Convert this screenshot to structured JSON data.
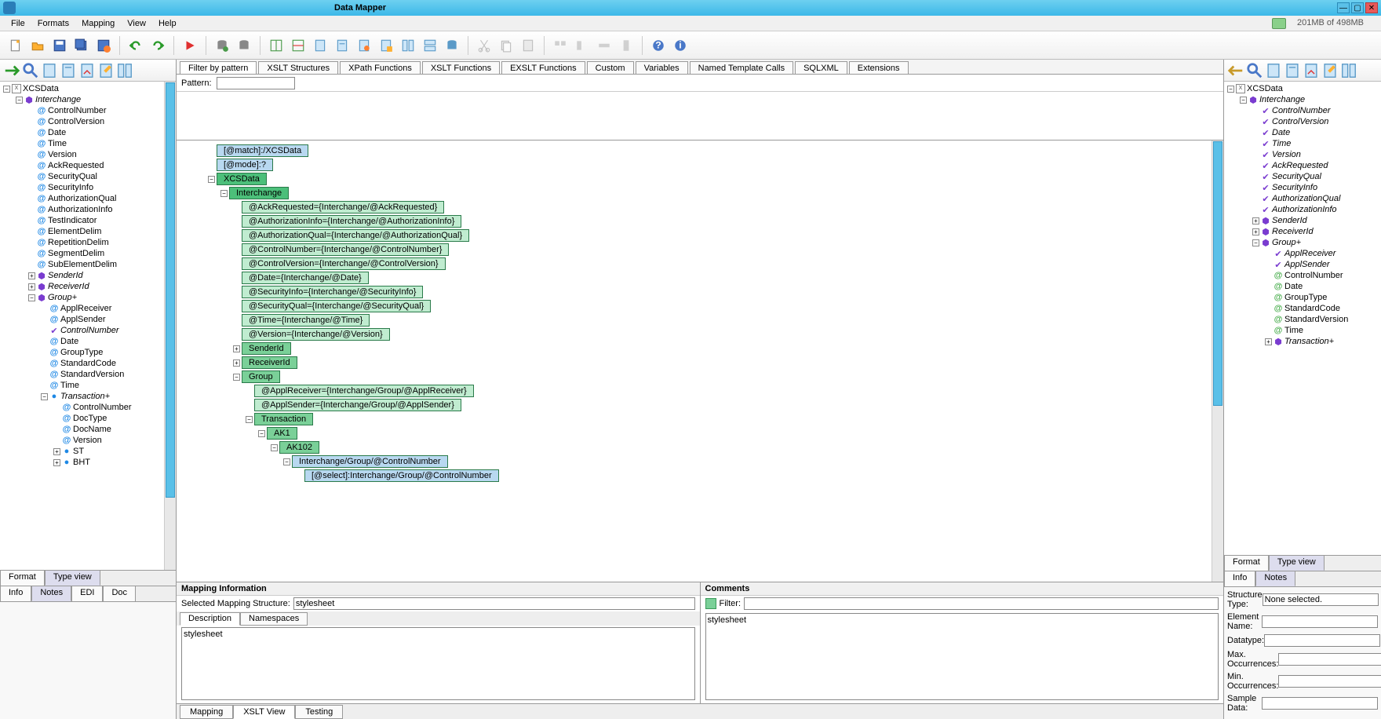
{
  "title": "Data Mapper",
  "memory": "201MB of 498MB",
  "menu": [
    "File",
    "Formats",
    "Mapping",
    "View",
    "Help"
  ],
  "center_tabs": [
    "Filter by pattern",
    "XSLT Structures",
    "XPath Functions",
    "XSLT Functions",
    "EXSLT Functions",
    "Custom",
    "Variables",
    "Named Template Calls",
    "SQLXML",
    "Extensions"
  ],
  "pattern_label": "Pattern:",
  "left_btabs1": [
    "Format",
    "Type view"
  ],
  "left_btabs2": [
    "Info",
    "Notes",
    "EDI",
    "Doc"
  ],
  "right_btabs1": [
    "Format",
    "Type view"
  ],
  "right_btabs2": [
    "Info",
    "Notes"
  ],
  "center_btabs": [
    "Mapping",
    "XSLT View",
    "Testing"
  ],
  "mapping_info": {
    "title": "Mapping Information",
    "sel_label": "Selected Mapping Structure:",
    "sel_value": "stylesheet",
    "sub_tabs": [
      "Description",
      "Namespaces"
    ],
    "desc": "stylesheet"
  },
  "comments": {
    "title": "Comments",
    "filter_label": "Filter:",
    "body": "stylesheet"
  },
  "right_details": {
    "structure_type": {
      "label": "Structure Type:",
      "value": "None selected."
    },
    "element_name": {
      "label": "Element Name:",
      "value": ""
    },
    "datatype": {
      "label": "Datatype:",
      "value": ""
    },
    "max_occ": {
      "label": "Max. Occurrences:",
      "value": ""
    },
    "min_occ": {
      "label": "Min. Occurrences:",
      "value": ""
    },
    "sample": {
      "label": "Sample Data:",
      "value": ""
    }
  },
  "left_tree": [
    {
      "d": 0,
      "tog": "-",
      "ico": "x",
      "t": "XCSData",
      "it": false
    },
    {
      "d": 1,
      "tog": "-",
      "ico": "shield",
      "t": "Interchange",
      "it": true
    },
    {
      "d": 2,
      "tog": "",
      "ico": "at",
      "t": "ControlNumber"
    },
    {
      "d": 2,
      "tog": "",
      "ico": "at",
      "t": "ControlVersion"
    },
    {
      "d": 2,
      "tog": "",
      "ico": "at",
      "t": "Date"
    },
    {
      "d": 2,
      "tog": "",
      "ico": "at",
      "t": "Time"
    },
    {
      "d": 2,
      "tog": "",
      "ico": "at",
      "t": "Version"
    },
    {
      "d": 2,
      "tog": "",
      "ico": "at",
      "t": "AckRequested"
    },
    {
      "d": 2,
      "tog": "",
      "ico": "at",
      "t": "SecurityQual"
    },
    {
      "d": 2,
      "tog": "",
      "ico": "at",
      "t": "SecurityInfo"
    },
    {
      "d": 2,
      "tog": "",
      "ico": "at",
      "t": "AuthorizationQual"
    },
    {
      "d": 2,
      "tog": "",
      "ico": "at",
      "t": "AuthorizationInfo"
    },
    {
      "d": 2,
      "tog": "",
      "ico": "at",
      "t": "TestIndicator"
    },
    {
      "d": 2,
      "tog": "",
      "ico": "at",
      "t": "ElementDelim"
    },
    {
      "d": 2,
      "tog": "",
      "ico": "at",
      "t": "RepetitionDelim"
    },
    {
      "d": 2,
      "tog": "",
      "ico": "at",
      "t": "SegmentDelim"
    },
    {
      "d": 2,
      "tog": "",
      "ico": "at",
      "t": "SubElementDelim"
    },
    {
      "d": 2,
      "tog": "+",
      "ico": "shield",
      "t": "SenderId",
      "it": true
    },
    {
      "d": 2,
      "tog": "+",
      "ico": "shield",
      "t": "ReceiverId",
      "it": true
    },
    {
      "d": 2,
      "tog": "-",
      "ico": "shield",
      "t": "Group+",
      "it": true
    },
    {
      "d": 3,
      "tog": "",
      "ico": "at",
      "t": "ApplReceiver"
    },
    {
      "d": 3,
      "tog": "",
      "ico": "at",
      "t": "ApplSender"
    },
    {
      "d": 3,
      "tog": "",
      "ico": "check",
      "t": "ControlNumber",
      "it": true
    },
    {
      "d": 3,
      "tog": "",
      "ico": "at",
      "t": "Date"
    },
    {
      "d": 3,
      "tog": "",
      "ico": "at",
      "t": "GroupType"
    },
    {
      "d": 3,
      "tog": "",
      "ico": "at",
      "t": "StandardCode"
    },
    {
      "d": 3,
      "tog": "",
      "ico": "at",
      "t": "StandardVersion"
    },
    {
      "d": 3,
      "tog": "",
      "ico": "at",
      "t": "Time"
    },
    {
      "d": 3,
      "tog": "-",
      "ico": "dot",
      "t": "Transaction+",
      "it": true
    },
    {
      "d": 4,
      "tog": "",
      "ico": "at",
      "t": "ControlNumber"
    },
    {
      "d": 4,
      "tog": "",
      "ico": "at",
      "t": "DocType"
    },
    {
      "d": 4,
      "tog": "",
      "ico": "at",
      "t": "DocName"
    },
    {
      "d": 4,
      "tog": "",
      "ico": "at",
      "t": "Version"
    },
    {
      "d": 4,
      "tog": "+",
      "ico": "dot",
      "t": "ST"
    },
    {
      "d": 4,
      "tog": "+",
      "ico": "dot",
      "t": "BHT"
    }
  ],
  "right_tree": [
    {
      "d": 0,
      "tog": "-",
      "ico": "x",
      "t": "XCSData",
      "it": false
    },
    {
      "d": 1,
      "tog": "-",
      "ico": "shield",
      "t": "Interchange",
      "it": true
    },
    {
      "d": 2,
      "tog": "",
      "ico": "check",
      "t": "ControlNumber",
      "it": true
    },
    {
      "d": 2,
      "tog": "",
      "ico": "check",
      "t": "ControlVersion",
      "it": true
    },
    {
      "d": 2,
      "tog": "",
      "ico": "check",
      "t": "Date",
      "it": true
    },
    {
      "d": 2,
      "tog": "",
      "ico": "check",
      "t": "Time",
      "it": true
    },
    {
      "d": 2,
      "tog": "",
      "ico": "check",
      "t": "Version",
      "it": true
    },
    {
      "d": 2,
      "tog": "",
      "ico": "check",
      "t": "AckRequested",
      "it": true
    },
    {
      "d": 2,
      "tog": "",
      "ico": "check",
      "t": "SecurityQual",
      "it": true
    },
    {
      "d": 2,
      "tog": "",
      "ico": "check",
      "t": "SecurityInfo",
      "it": true
    },
    {
      "d": 2,
      "tog": "",
      "ico": "check",
      "t": "AuthorizationQual",
      "it": true
    },
    {
      "d": 2,
      "tog": "",
      "ico": "check",
      "t": "AuthorizationInfo",
      "it": true
    },
    {
      "d": 2,
      "tog": "+",
      "ico": "shield",
      "t": "SenderId",
      "it": true
    },
    {
      "d": 2,
      "tog": "+",
      "ico": "shield",
      "t": "ReceiverId",
      "it": true
    },
    {
      "d": 2,
      "tog": "-",
      "ico": "shield",
      "t": "Group+",
      "it": true
    },
    {
      "d": 3,
      "tog": "",
      "ico": "check",
      "t": "ApplReceiver",
      "it": true
    },
    {
      "d": 3,
      "tog": "",
      "ico": "check",
      "t": "ApplSender",
      "it": true
    },
    {
      "d": 3,
      "tog": "",
      "ico": "atg",
      "t": "ControlNumber"
    },
    {
      "d": 3,
      "tog": "",
      "ico": "atg",
      "t": "Date"
    },
    {
      "d": 3,
      "tog": "",
      "ico": "atg",
      "t": "GroupType"
    },
    {
      "d": 3,
      "tog": "",
      "ico": "atg",
      "t": "StandardCode"
    },
    {
      "d": 3,
      "tog": "",
      "ico": "atg",
      "t": "StandardVersion"
    },
    {
      "d": 3,
      "tog": "",
      "ico": "atg",
      "t": "Time"
    },
    {
      "d": 3,
      "tog": "+",
      "ico": "shield",
      "t": "Transaction+",
      "it": true
    }
  ],
  "map_nodes": [
    {
      "d": 0,
      "tog": "",
      "cls": "blue",
      "t": "[@match]:/XCSData"
    },
    {
      "d": 0,
      "tog": "",
      "cls": "blue",
      "t": "[@mode]:?"
    },
    {
      "d": 0,
      "tog": "-",
      "cls": "dk",
      "t": "XCSData"
    },
    {
      "d": 1,
      "tog": "-",
      "cls": "dk",
      "t": "Interchange"
    },
    {
      "d": 2,
      "tog": "",
      "cls": "lt",
      "t": "@AckRequested={Interchange/@AckRequested}"
    },
    {
      "d": 2,
      "tog": "",
      "cls": "lt",
      "t": "@AuthorizationInfo={Interchange/@AuthorizationInfo}"
    },
    {
      "d": 2,
      "tog": "",
      "cls": "lt",
      "t": "@AuthorizationQual={Interchange/@AuthorizationQual}"
    },
    {
      "d": 2,
      "tog": "",
      "cls": "lt",
      "t": "@ControlNumber={Interchange/@ControlNumber}"
    },
    {
      "d": 2,
      "tog": "",
      "cls": "lt",
      "t": "@ControlVersion={Interchange/@ControlVersion}"
    },
    {
      "d": 2,
      "tog": "",
      "cls": "lt",
      "t": "@Date={Interchange/@Date}"
    },
    {
      "d": 2,
      "tog": "",
      "cls": "lt",
      "t": "@SecurityInfo={Interchange/@SecurityInfo}"
    },
    {
      "d": 2,
      "tog": "",
      "cls": "lt",
      "t": "@SecurityQual={Interchange/@SecurityQual}"
    },
    {
      "d": 2,
      "tog": "",
      "cls": "lt",
      "t": "@Time={Interchange/@Time}"
    },
    {
      "d": 2,
      "tog": "",
      "cls": "lt",
      "t": "@Version={Interchange/@Version}"
    },
    {
      "d": 2,
      "tog": "+",
      "cls": "md",
      "t": "SenderId"
    },
    {
      "d": 2,
      "tog": "+",
      "cls": "md",
      "t": "ReceiverId"
    },
    {
      "d": 2,
      "tog": "-",
      "cls": "md",
      "t": "Group"
    },
    {
      "d": 3,
      "tog": "",
      "cls": "lt",
      "t": "@ApplReceiver={Interchange/Group/@ApplReceiver}"
    },
    {
      "d": 3,
      "tog": "",
      "cls": "lt",
      "t": "@ApplSender={Interchange/Group/@ApplSender}"
    },
    {
      "d": 3,
      "tog": "-",
      "cls": "md",
      "t": "Transaction"
    },
    {
      "d": 4,
      "tog": "-",
      "cls": "md",
      "t": "AK1"
    },
    {
      "d": 5,
      "tog": "-",
      "cls": "md",
      "t": "AK102"
    },
    {
      "d": 6,
      "tog": "-",
      "cls": "blue",
      "t": "Interchange/Group/@ControlNumber"
    },
    {
      "d": 7,
      "tog": "",
      "cls": "blue",
      "t": "[@select]:Interchange/Group/@ControlNumber"
    }
  ]
}
